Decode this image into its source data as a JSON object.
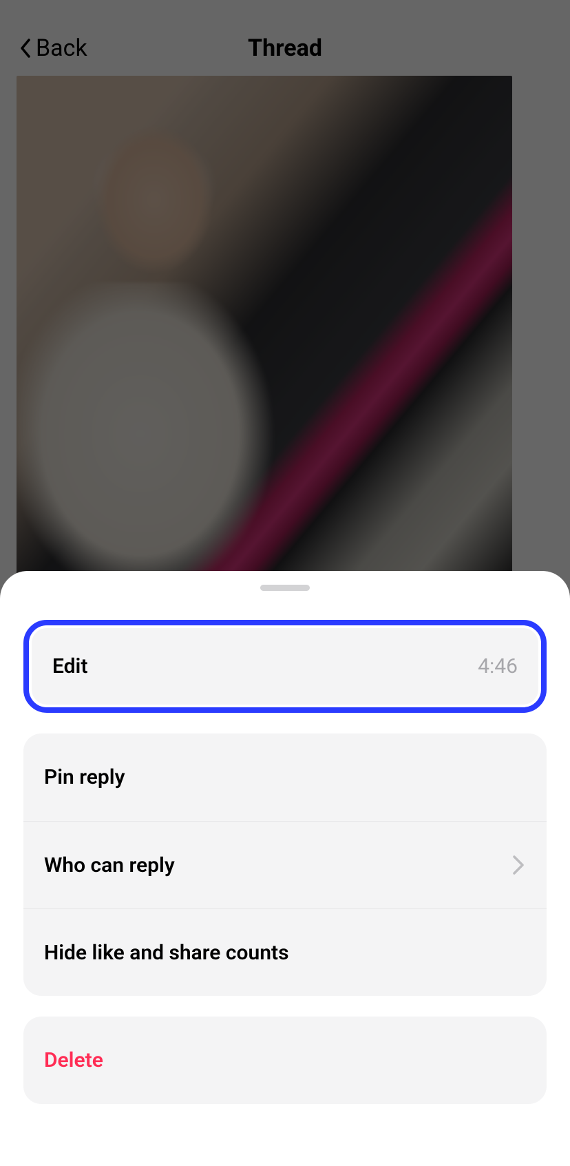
{
  "header": {
    "back_label": "Back",
    "title": "Thread"
  },
  "sheet": {
    "edit": {
      "label": "Edit",
      "time": "4:46"
    },
    "pin_label": "Pin reply",
    "who_label": "Who can reply",
    "hide_label": "Hide like and share counts",
    "delete_label": "Delete"
  }
}
